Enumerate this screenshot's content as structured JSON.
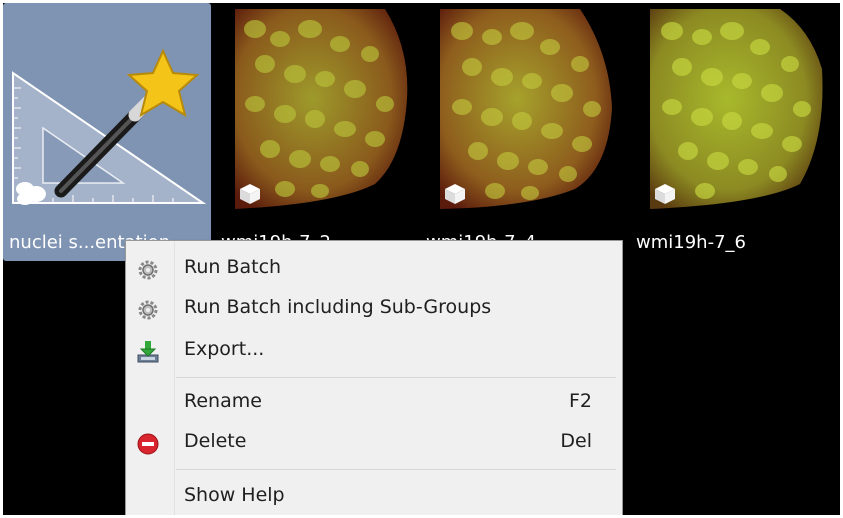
{
  "tiles": [
    {
      "label": "nuclei s...entation",
      "selected": true,
      "kind": "segmentation-tool"
    },
    {
      "label": "wmi19h-7_2",
      "selected": false,
      "kind": "image"
    },
    {
      "label": "wmi19h-7_4",
      "selected": false,
      "kind": "image"
    },
    {
      "label": "wmi19h-7_6",
      "selected": false,
      "kind": "image"
    }
  ],
  "context_menu": {
    "items": [
      {
        "label": "Run Batch",
        "icon": "gear-icon",
        "shortcut": ""
      },
      {
        "label": "Run Batch including Sub-Groups",
        "icon": "gear-icon",
        "shortcut": ""
      },
      {
        "label": "Export...",
        "icon": "export-icon",
        "shortcut": ""
      },
      {
        "label": "Rename",
        "icon": "",
        "shortcut": "F2"
      },
      {
        "label": "Delete",
        "icon": "delete-icon",
        "shortcut": "Del"
      },
      {
        "label": "Show Help",
        "icon": "",
        "shortcut": ""
      }
    ]
  },
  "colors": {
    "background": "#000000",
    "selection": "#7f93b2",
    "menu_bg": "#f0f0f0",
    "delete_red": "#d9262e"
  }
}
